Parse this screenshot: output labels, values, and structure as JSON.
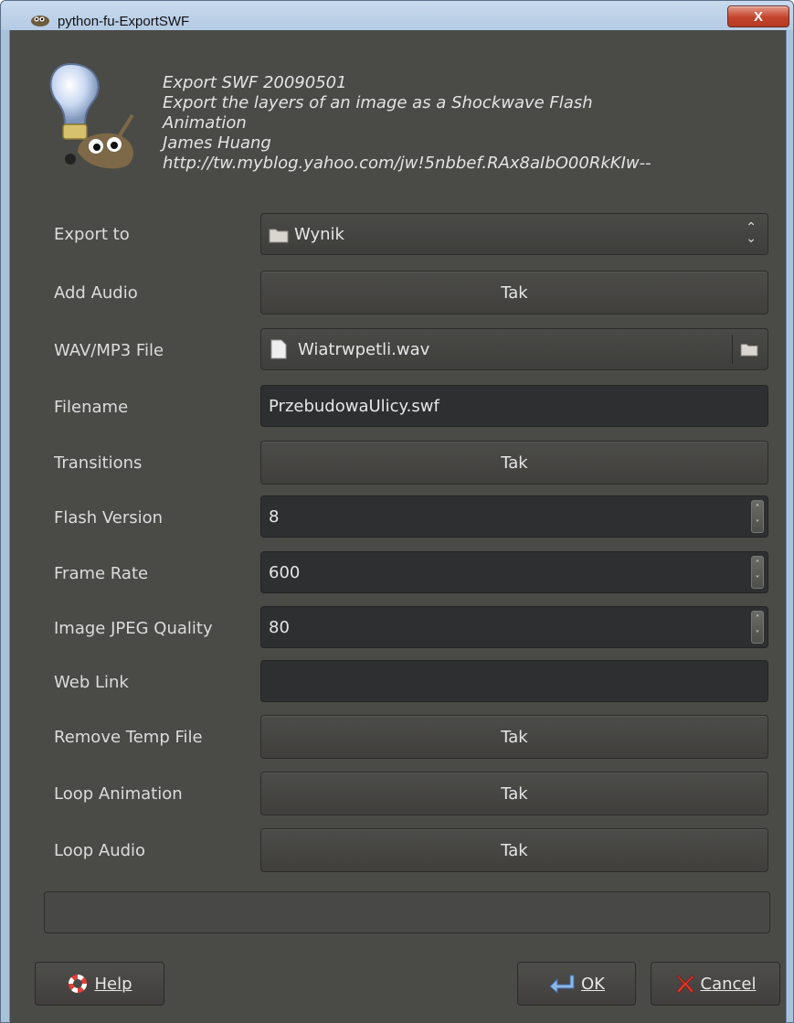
{
  "window": {
    "title": "python-fu-ExportSWF",
    "close_label": "X"
  },
  "header": {
    "lines": [
      "Export SWF 20090501",
      "Export the layers of an image as a Shockwave Flash",
      "Animation",
      "James Huang",
      "http://tw.myblog.yahoo.com/jw!5nbbef.RAx8aIbO00RkKIw--"
    ]
  },
  "fields": {
    "export_to": {
      "label": "Export to",
      "value": "Wynik",
      "icon": "folder-icon"
    },
    "add_audio": {
      "label": "Add Audio",
      "value": "Tak"
    },
    "wav_file": {
      "label": "WAV/MP3 File",
      "value": "Wiatrwpetli.wav",
      "icon": "file-icon"
    },
    "filename": {
      "label": "Filename",
      "value": "PrzebudowaUlicy.swf"
    },
    "transitions": {
      "label": "Transitions",
      "value": "Tak"
    },
    "flash_version": {
      "label": "Flash Version",
      "value": "8"
    },
    "frame_rate": {
      "label": "Frame Rate",
      "value": "600"
    },
    "jpeg_quality": {
      "label": "Image JPEG Quality",
      "value": "80"
    },
    "web_link": {
      "label": "Web Link",
      "value": ""
    },
    "remove_temp": {
      "label": "Remove Temp File",
      "value": "Tak"
    },
    "loop_animation": {
      "label": "Loop Animation",
      "value": "Tak"
    },
    "loop_audio": {
      "label": "Loop Audio",
      "value": "Tak"
    }
  },
  "buttons": {
    "help": "Help",
    "ok": "OK",
    "cancel": "Cancel"
  },
  "colors": {
    "dialog_bg": "#4a4a47",
    "entry_bg": "#2d2f30",
    "text": "#e6e6e6",
    "title_bar": "#b4cbe4",
    "close_red": "#c2432b"
  }
}
